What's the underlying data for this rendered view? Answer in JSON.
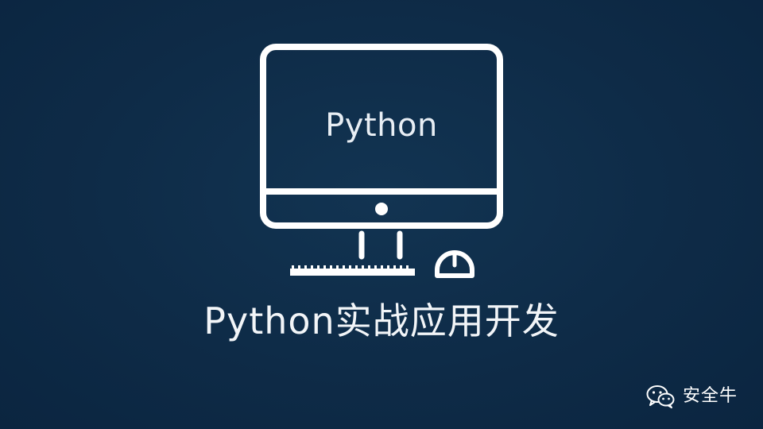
{
  "colors": {
    "background": "#0e2b47",
    "foreground": "#ffffff"
  },
  "illustration": {
    "screen_text": "Python",
    "icon_name": "desktop-computer-icon"
  },
  "headline": "Python实战应用开发",
  "watermark": {
    "icon_name": "wechat-icon",
    "text": "安全牛"
  }
}
